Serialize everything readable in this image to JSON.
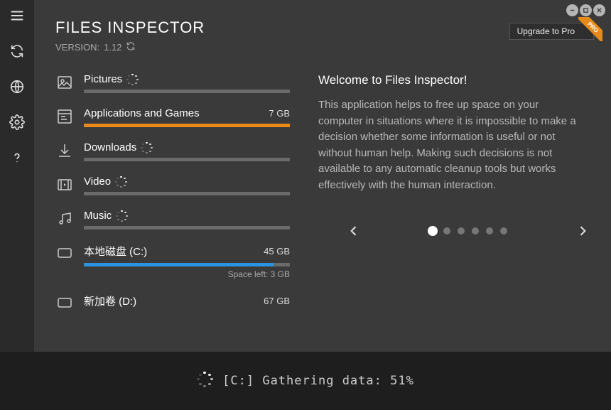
{
  "header": {
    "title": "FILES INSPECTOR",
    "version_prefix": "VERSION:",
    "version": "1.12",
    "upgrade_label": "Upgrade to Pro"
  },
  "categories": [
    {
      "id": "pictures",
      "label": "Pictures",
      "size": "",
      "loading": true,
      "fill_pct": 0,
      "fill_color": "#6a6a6a",
      "sub": ""
    },
    {
      "id": "apps",
      "label": "Applications and Games",
      "size": "7 GB",
      "loading": false,
      "fill_pct": 100,
      "fill_color": "#e88a1a",
      "sub": ""
    },
    {
      "id": "downloads",
      "label": "Downloads",
      "size": "",
      "loading": true,
      "fill_pct": 0,
      "fill_color": "#6a6a6a",
      "sub": ""
    },
    {
      "id": "video",
      "label": "Video",
      "size": "",
      "loading": true,
      "fill_pct": 0,
      "fill_color": "#6a6a6a",
      "sub": ""
    },
    {
      "id": "music",
      "label": "Music",
      "size": "",
      "loading": true,
      "fill_pct": 0,
      "fill_color": "#6a6a6a",
      "sub": ""
    },
    {
      "id": "drive_c",
      "label": "本地磁盘 (C:)",
      "size": "45 GB",
      "loading": false,
      "fill_pct": 92,
      "fill_color": "#2a94e0",
      "sub": "Space left: 3 GB"
    },
    {
      "id": "drive_d",
      "label": "新加卷 (D:)",
      "size": "67 GB",
      "loading": false,
      "fill_pct": 0,
      "fill_color": "#6a6a6a",
      "sub": "",
      "no_bar": true
    }
  ],
  "welcome": {
    "heading": "Welcome to Files Inspector!",
    "body": "This application helps to free up space on your computer in situations where it is impossible to make a decision whether some information is useful or not without human help. Making such decisions is not available to any automatic cleanup tools but works effectively with the human interaction."
  },
  "pager": {
    "count": 6,
    "active": 0
  },
  "status": {
    "text": "[C:] Gathering data: 51%"
  }
}
